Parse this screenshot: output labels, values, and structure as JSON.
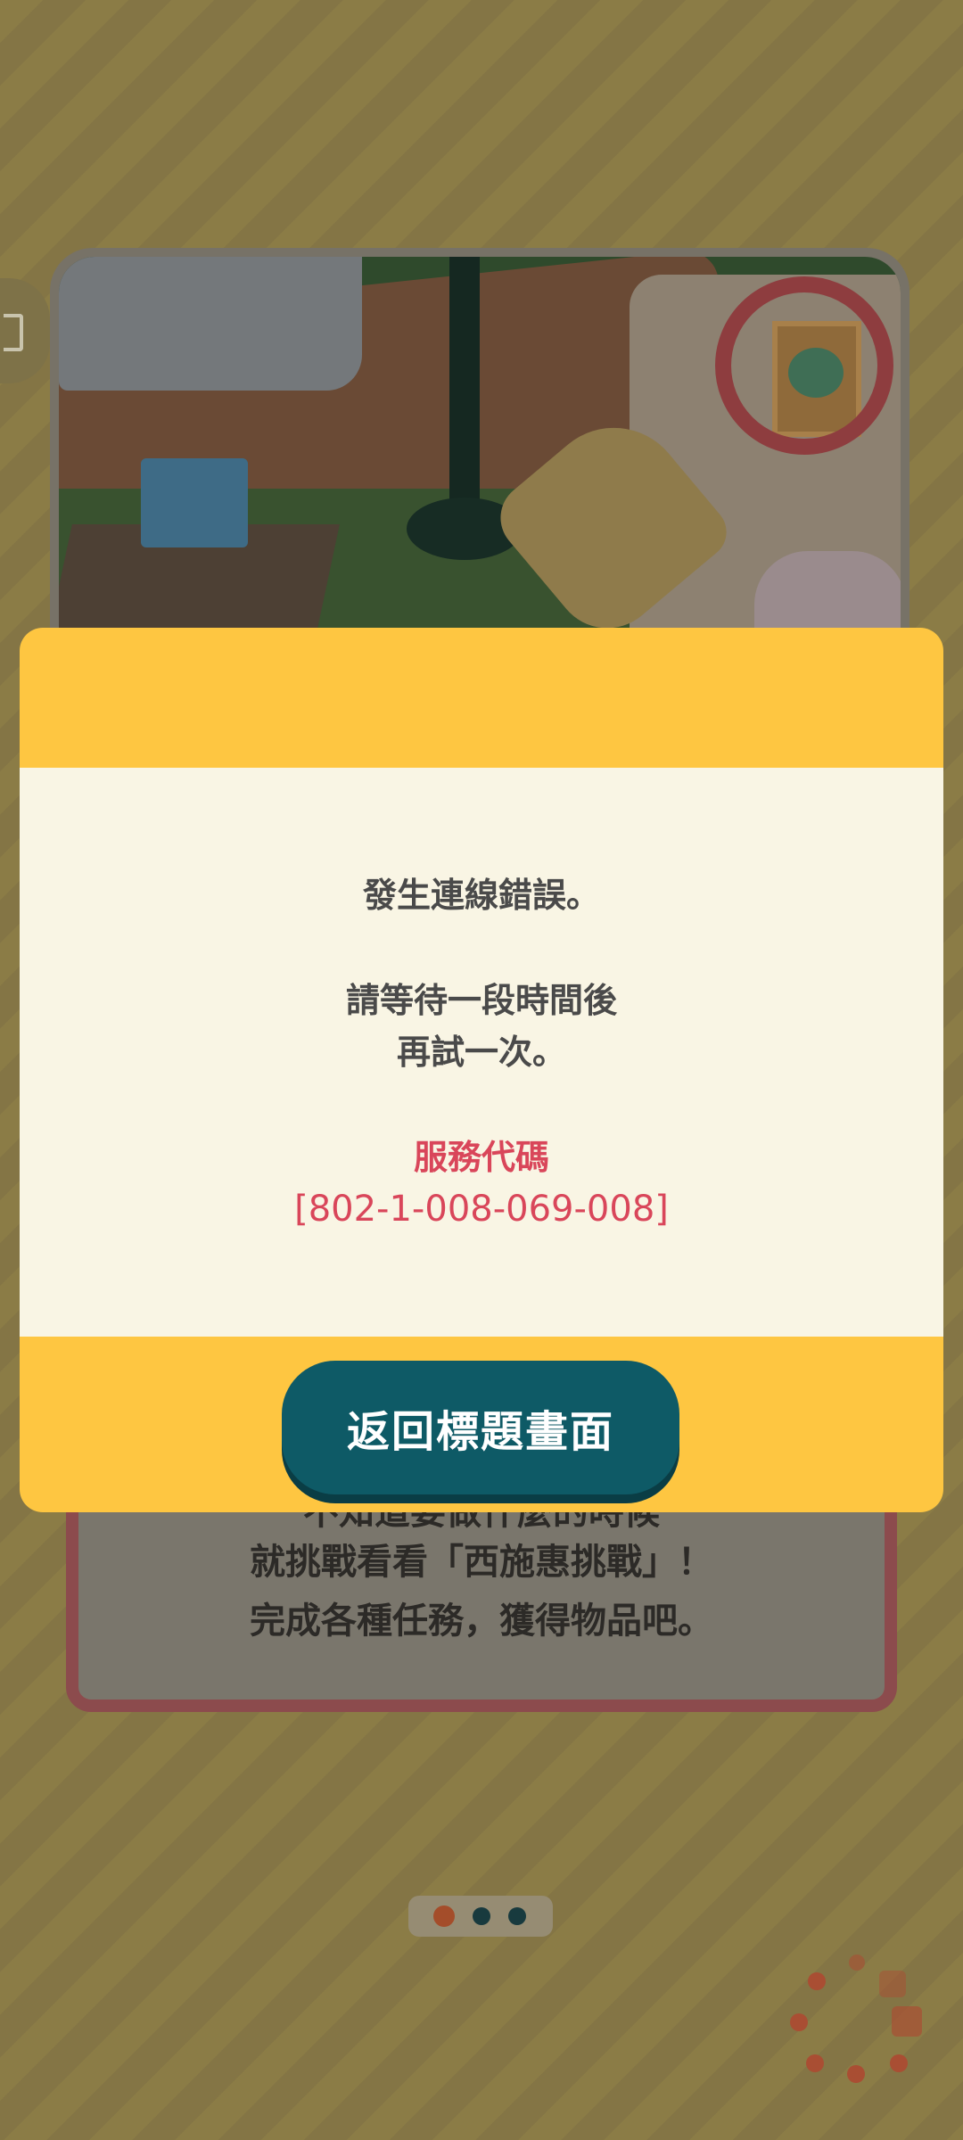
{
  "background": {
    "caption": {
      "line1": "不知道要做什麼的時候",
      "line2": "就挑戰看看「西施惠挑戰」！",
      "line3": "完成各種任務，獲得物品吧。"
    },
    "pager": {
      "page_count": 3,
      "active_index": 0
    }
  },
  "dialog": {
    "message_line1": "發生連線錯誤。",
    "message_line2": "請等待一段時間後",
    "message_line3": "再試一次。",
    "service_code_label": "服務代碼",
    "service_code": "[802-1-008-069-008]",
    "back_button_label": "返回標題畫面"
  },
  "colors": {
    "dialog_header": "#fec641",
    "dialog_body": "#f9f5e4",
    "button": "#0e5a66",
    "error_code": "#d9465a"
  }
}
